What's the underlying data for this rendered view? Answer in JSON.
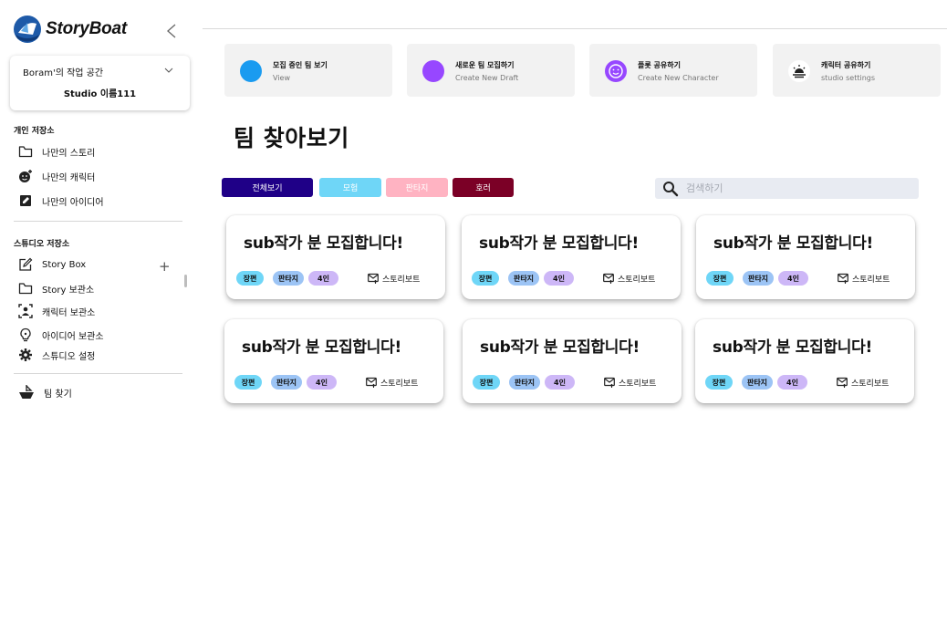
{
  "app": {
    "logo_text": "StoryBoat"
  },
  "workspace": {
    "name": "Boram'의 작업 공간",
    "studio": "Studio 이름111"
  },
  "sidebar": {
    "personal_title": "개인 저장소",
    "personal_items": [
      {
        "label": "나만의 스토리",
        "icon": "folder-icon"
      },
      {
        "label": "나만의 캐릭터",
        "icon": "face-plus-icon"
      },
      {
        "label": "나만의 아이디어",
        "icon": "note-edit-icon"
      }
    ],
    "studio_title": "스튜디오 저장소",
    "studio_items": [
      {
        "label": "Story Box",
        "icon": "edit-icon"
      },
      {
        "label": "Story 보관소",
        "icon": "folder-icon"
      },
      {
        "label": "캐릭터 보관소",
        "icon": "person-frame-icon"
      },
      {
        "label": "아이디어 보관소",
        "icon": "lightbulb-icon"
      },
      {
        "label": "스튜디오 설정",
        "icon": "gear-icon"
      }
    ],
    "team_item": {
      "label": "팀 찾기",
      "icon": "boat-icon"
    }
  },
  "quick_actions": [
    {
      "title": "모집 중인 팀 보기",
      "subtitle": "View",
      "color": "#1a9bf0"
    },
    {
      "title": "새로운 팀 모집하기",
      "subtitle": "Create New Draft",
      "color": "#9747ff"
    },
    {
      "title": "플롯 공유하기",
      "subtitle": "Create New Character",
      "color": "#9747ff"
    },
    {
      "title": "캐릭터 공유하기",
      "subtitle": "studio settings",
      "color": "#ffffff"
    }
  ],
  "page": {
    "title": "팀 찾아보기"
  },
  "filters": [
    {
      "label": "전체보기",
      "bg": "#1f0087",
      "fg": "#ffffff"
    },
    {
      "label": "모험",
      "bg": "#6fd6f7",
      "fg": "#ffffff"
    },
    {
      "label": "판타지",
      "bg": "#ffb3c2",
      "fg": "#ffffff"
    },
    {
      "label": "호러",
      "bg": "#7b0026",
      "fg": "#ffffff"
    }
  ],
  "search": {
    "placeholder": "검색하기"
  },
  "cards": [
    {
      "title": "sub작가 분 모집합니다!",
      "tags": [
        "장편",
        "판타지",
        "4인"
      ],
      "brand": "스토리보트"
    },
    {
      "title": "sub작가 분 모집합니다!",
      "tags": [
        "장편",
        "판타지",
        "4인"
      ],
      "brand": "스토리보트"
    },
    {
      "title": "sub작가 분 모집합니다!",
      "tags": [
        "장편",
        "판타지",
        "4인"
      ],
      "brand": "스토리보트"
    },
    {
      "title": "sub작가 분 모집합니다!",
      "tags": [
        "장편",
        "판타지",
        "4인"
      ],
      "brand": "스토리보트"
    },
    {
      "title": "sub작가 분 모집합니다!",
      "tags": [
        "장편",
        "판타지",
        "4인"
      ],
      "brand": "스토리보트"
    },
    {
      "title": "sub작가 분 모집합니다!",
      "tags": [
        "장편",
        "판타지",
        "4인"
      ],
      "brand": "스토리보트"
    }
  ],
  "tag_colors": [
    "#6fd6f7",
    "#9cc4f5",
    "#cdb7f7"
  ]
}
